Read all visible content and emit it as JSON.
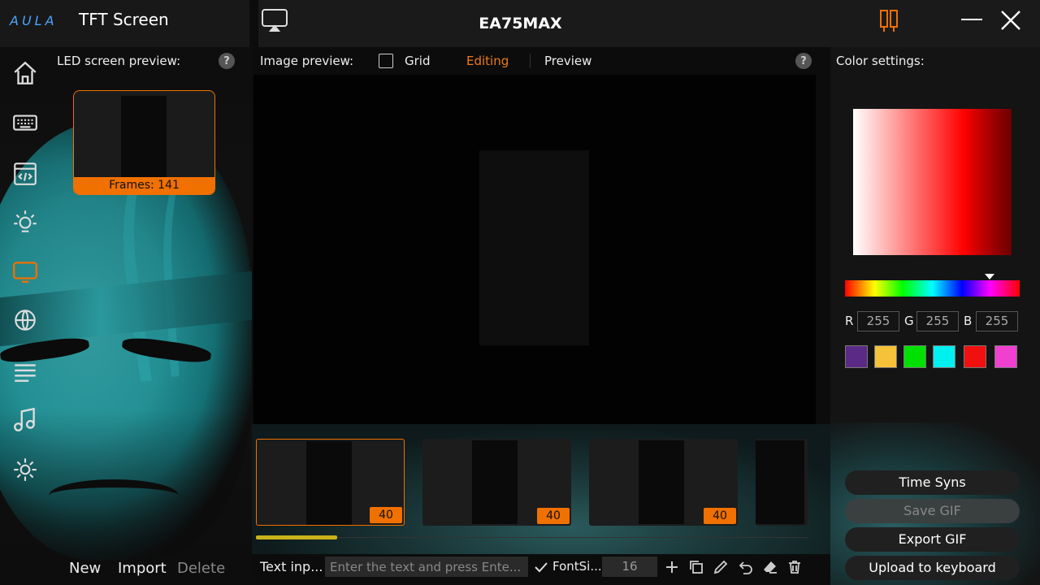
{
  "app": {
    "logo": "AULA",
    "title": "TFT Screen",
    "device": "EA75MAX"
  },
  "nav": {
    "items": [
      {
        "name": "home"
      },
      {
        "name": "keyboard"
      },
      {
        "name": "macro"
      },
      {
        "name": "lighting"
      },
      {
        "name": "tft-screen",
        "active": true
      },
      {
        "name": "network"
      },
      {
        "name": "list"
      },
      {
        "name": "music"
      },
      {
        "name": "settings"
      }
    ]
  },
  "led": {
    "title": "LED screen preview:",
    "help": "?",
    "frames_label": "Frames: 141"
  },
  "left_actions": {
    "new": "New",
    "import": "Import",
    "delete": "Delete"
  },
  "image": {
    "title": "Image preview:",
    "grid_label": "Grid",
    "grid_checked": false,
    "tab_editing": "Editing",
    "tab_preview": "Preview",
    "help": "?"
  },
  "frames": [
    {
      "badge": "40",
      "selected": true
    },
    {
      "badge": "40",
      "selected": false
    },
    {
      "badge": "40",
      "selected": false
    }
  ],
  "text_tools": {
    "label": "Text inp...",
    "placeholder": "Enter the text and press Ente...",
    "fontsize_label": "FontSi...",
    "fontsize_value": "16"
  },
  "color": {
    "title": "Color settings:",
    "r_label": "R",
    "g_label": "G",
    "b_label": "B",
    "r": "255",
    "g": "255",
    "b": "255",
    "hue_position": 0.83,
    "swatches": [
      "#5b2a86",
      "#f5c23a",
      "#00e000",
      "#00f0f0",
      "#f01010",
      "#f040d0"
    ]
  },
  "buttons": {
    "time_sync": "Time Syns",
    "save_gif": "Save GIF",
    "export_gif": "Export GIF",
    "upload": "Upload to keyboard"
  },
  "colors": {
    "accent": "#f07000",
    "editing": "#f07a1a",
    "scrollbar": "#c9b21a"
  }
}
